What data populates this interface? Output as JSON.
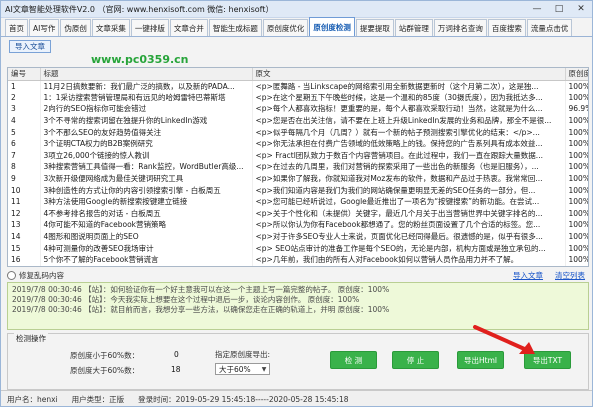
{
  "window": {
    "title": "AI文章智能处理软件V2.0 （官网: www.henxisoft.com    微信: henxisoft）",
    "minimize": "—",
    "maximize": "□",
    "close": "✕"
  },
  "tabs": [
    {
      "label": "首页"
    },
    {
      "label": "AI写作"
    },
    {
      "label": "伪原创"
    },
    {
      "label": "文章采集"
    },
    {
      "label": "一键排版"
    },
    {
      "label": "文章合并"
    },
    {
      "label": "智能生成标题"
    },
    {
      "label": "原创度优化"
    },
    {
      "label": "原创度检测"
    },
    {
      "label": "提要提取"
    },
    {
      "label": "站群管理"
    },
    {
      "label": "万词排名查询"
    },
    {
      "label": "百度搜索"
    },
    {
      "label": "流量点击优"
    }
  ],
  "toolbar": {
    "import_label": "导入文章"
  },
  "watermark": "www.pc0359.cn",
  "table": {
    "headers": [
      "编号",
      "标题",
      "原文",
      "原创度"
    ],
    "rows": [
      {
        "no": "1",
        "title": "11月2日搞数要新：我们最广泛的搞数，以及新的PADA...",
        "src": "<p>匿舞路 - 当Linkscape的网络索引用全新数据更新时（这个月第二次），这是独...",
        "pct": "100%"
      },
      {
        "no": "2",
        "title": "1：1采访搜索营销管理局和有远见的哈姆雷特巴蒂斯塔",
        "src": "<p>在这个星期五下午晚些时候，这是一个温和的85度（30摄氏度），因为我抵达多...",
        "pct": "100%"
      },
      {
        "no": "3",
        "title": "2向行的SEO指标你可能会错过",
        "src": "<p>每个人都喜欢指标！更重要的是，每个人都喜欢采取行动！当然，这就是为什么...",
        "pct": "96.9%"
      },
      {
        "no": "4",
        "title": "3个不寻常的搜索词留在独提升你的LinkedIn游戏",
        "src": "<p>您是否在出关注信，请不要在上班上升级LinkedIn发展的业务和品牌，那全不是很...",
        "pct": "100%"
      },
      {
        "no": "5",
        "title": "3个不那么SEO的友好趋势值得关注",
        "src": "<p>似乎每隔几个月（几周？）就有一个新的帖子预测搜索引擎优化的结束：</p>...",
        "pct": "100%"
      },
      {
        "no": "6",
        "title": "3个证明CTA权力的B2B案例研究",
        "src": "<p>你无法承担在付费广告领域的低效策略上的钱。保持您的广告系列具有成本效益...",
        "pct": "100%"
      },
      {
        "no": "7",
        "title": "3项立26,000个链接的惊人教训",
        "src": "<p> Fractl团队致力于数百个内容营销项目。在此过程中，我们一直在跟踪大量数据...",
        "pct": "100%"
      },
      {
        "no": "8",
        "title": "3种搜索营销工具值得一看：Rank监控，WordButler高级...",
        "src": "<p>在过去的几周里，我们对营销的探索采用了一些出色的新服务（也是旧服务），...",
        "pct": "100%"
      },
      {
        "no": "9",
        "title": "3次新开级便网络成为最佳关键词研究工具",
        "src": "<p>如果你了解我，你就知道我对Moz发布的软件，数据和产品过于热衷。我常常回...",
        "pct": "100%"
      },
      {
        "no": "10",
        "title": "3种创造性的方式让你的内容引领搜索引擎 - 白板周五",
        "src": "<p>我们知道内容是我们为我们的网站确保量更明显无差的SEO任务的一部分，但...",
        "pct": "100%"
      },
      {
        "no": "11",
        "title": "3种方法使用Google的新搜索按键建立链接",
        "src": "<p>您可能已经听说过，Google最近推出了一项名为“按键搜索”的新功能。在尝试...",
        "pct": "100%"
      },
      {
        "no": "12",
        "title": "4不参考排名报告的对话 - 白板周五",
        "src": "<p>关于个性化和（未提供）关键字，最近几个月关于出当营销世界中关键字排名的...",
        "pct": "100%"
      },
      {
        "no": "13",
        "title": "4你可能不知道的Facebook营销策略",
        "src": "<p>所以你认为你有Facebook都想通了。您的粉丝页面设置了几个合适的标签。您...",
        "pct": "100%"
      },
      {
        "no": "14",
        "title": "4图形和图说明页面上的SEO",
        "src": "<p>对于许多SEO专业人士来说，页面优化已经同得最后。很遗憾的是，似乎有很多...",
        "pct": "100%"
      },
      {
        "no": "15",
        "title": "4种可测量你的改善SEO我场审计",
        "src": "<p> SEO站点审计的准备工作是每个SEO的，无论是内部，机构方面或是独立承包的...",
        "pct": "100%"
      },
      {
        "no": "16",
        "title": "5个你不了解的Facebook营销谎言",
        "src": "<p>几年前，我们由的所有人对Facebook如何以营销人员作品用力并不了解。",
        "pct": "100%"
      }
    ]
  },
  "options": {
    "repair_label": "修复乱码内容",
    "export_article": "导入文章",
    "clear_list": "清空列表"
  },
  "log": [
    "2019/7/8 00:30:46 【站】：如何验证你有一个好主意我可以在这一个主题上写一篇完整的帖子。  原创度：100%",
    "2019/7/8 00:30:46 【站】：今天我实际上想要在这个过程中退后一步，谈论内容创作。  原创度：100%",
    "2019/7/8 00:30:46 【站】：就目前而言，我想分享一些方法，以确保您走在正确的轨道上，并明  原创度：100%"
  ],
  "ops": {
    "title": "检测操作",
    "below_label": "原创度小于60%数：",
    "below_value": "0",
    "above_label": "原创度大于60%数：",
    "above_value": "18",
    "export_prompt": "指定原创度导出:",
    "select_value": "大于60%",
    "detect_button": "检 测",
    "stop_button": "停 止",
    "export_html_button": "导出Html",
    "export_txt_button": "导出TXT"
  },
  "status": {
    "user": "用户名：henxi",
    "type": "用户类型：正版",
    "date": "登录时间：2019-05-29 15:45:18-----2020-05-28 15:45:18"
  },
  "colors": {
    "button_green": "#39b24a",
    "active_tab": "#1a5fb4",
    "log_bg": "#eef9d9",
    "arrow_red": "#e0201d"
  }
}
